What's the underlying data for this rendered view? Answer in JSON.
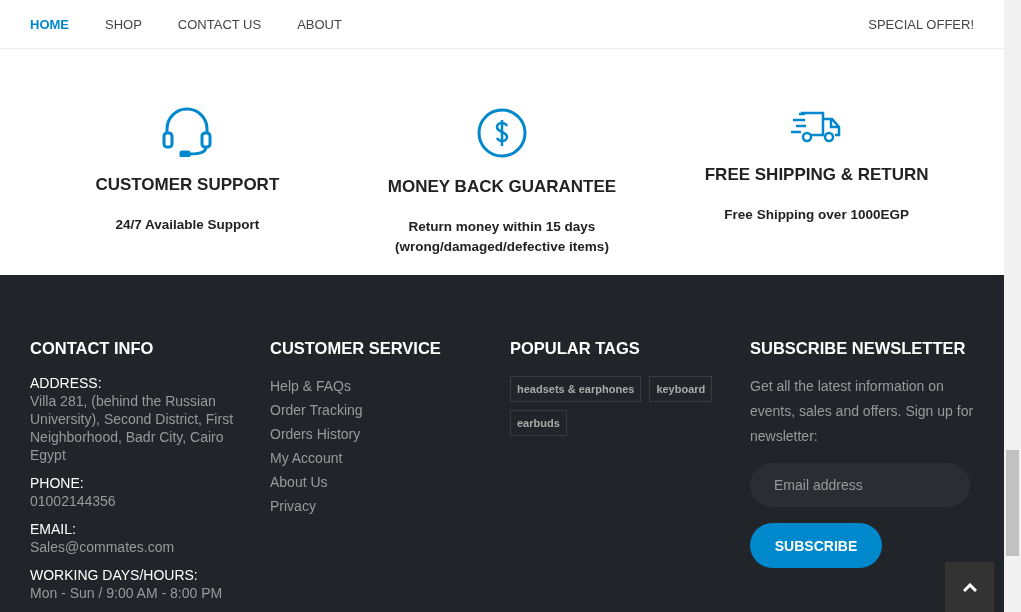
{
  "nav": {
    "items": [
      {
        "label": "HOME",
        "selected": true
      },
      {
        "label": "SHOP",
        "selected": false
      },
      {
        "label": "CONTACT US",
        "selected": false
      },
      {
        "label": "ABOUT",
        "selected": false
      }
    ],
    "offer": "SPECIAL OFFER!"
  },
  "features": [
    {
      "kind": "headset",
      "title": "CUSTOMER SUPPORT",
      "text": [
        "24/7 Available Support"
      ]
    },
    {
      "kind": "money",
      "title": "MONEY BACK GUARANTEE",
      "text": [
        "Return money within 15 days",
        "(wrong/damaged/defective items)"
      ]
    },
    {
      "kind": "truck",
      "title": "FREE SHIPPING & RETURN",
      "text": [
        "Free Shipping over 1000EGP"
      ]
    }
  ],
  "footer": {
    "contact": {
      "title": "CONTACT INFO",
      "entries": [
        {
          "label": "ADDRESS:",
          "value": "Villa 281, (behind the Russian University), Second District, First Neighborhood, Badr City, Cairo Egypt"
        },
        {
          "label": "PHONE:",
          "value": "01002144356"
        },
        {
          "label": "EMAIL:",
          "value": "Sales@commates.com"
        },
        {
          "label": "WORKING DAYS/HOURS:",
          "value": "Mon - Sun / 9:00 AM - 8:00 PM"
        }
      ]
    },
    "service": {
      "title": "CUSTOMER SERVICE",
      "links": [
        "Help & FAQs",
        "Order Tracking",
        "Orders History",
        "My Account",
        "About Us",
        "Privacy"
      ]
    },
    "tags": {
      "title": "POPULAR TAGS",
      "items": [
        "headsets & earphones",
        "keyboard",
        "earbuds"
      ]
    },
    "newsletter": {
      "title": "SUBSCRIBE NEWSLETTER",
      "text": "Get all the latest information on events, sales and offers. Sign up for newsletter:",
      "placeholder": "Email address",
      "button": "SUBSCRIBE"
    }
  }
}
